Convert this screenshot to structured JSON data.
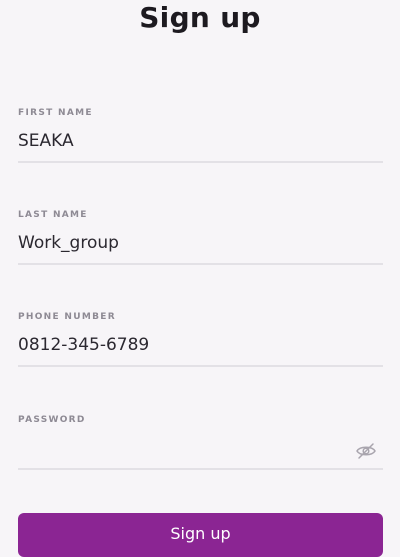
{
  "page": {
    "title": "Sign up"
  },
  "form": {
    "first_name": {
      "label": "FIRST NAME",
      "value": "SEAKA"
    },
    "last_name": {
      "label": "LAST NAME",
      "value": "Work_group"
    },
    "phone_number": {
      "label": "PHONE NUMBER",
      "value": "0812-345-6789"
    },
    "password": {
      "label": "PASSWORD",
      "value": "",
      "toggle_icon": "eye-off-icon"
    },
    "submit_label": "Sign up"
  },
  "colors": {
    "accent": "#8b2593",
    "label": "#8e8a94",
    "underline": "#e3e1e6",
    "background": "#f7f5f8"
  }
}
